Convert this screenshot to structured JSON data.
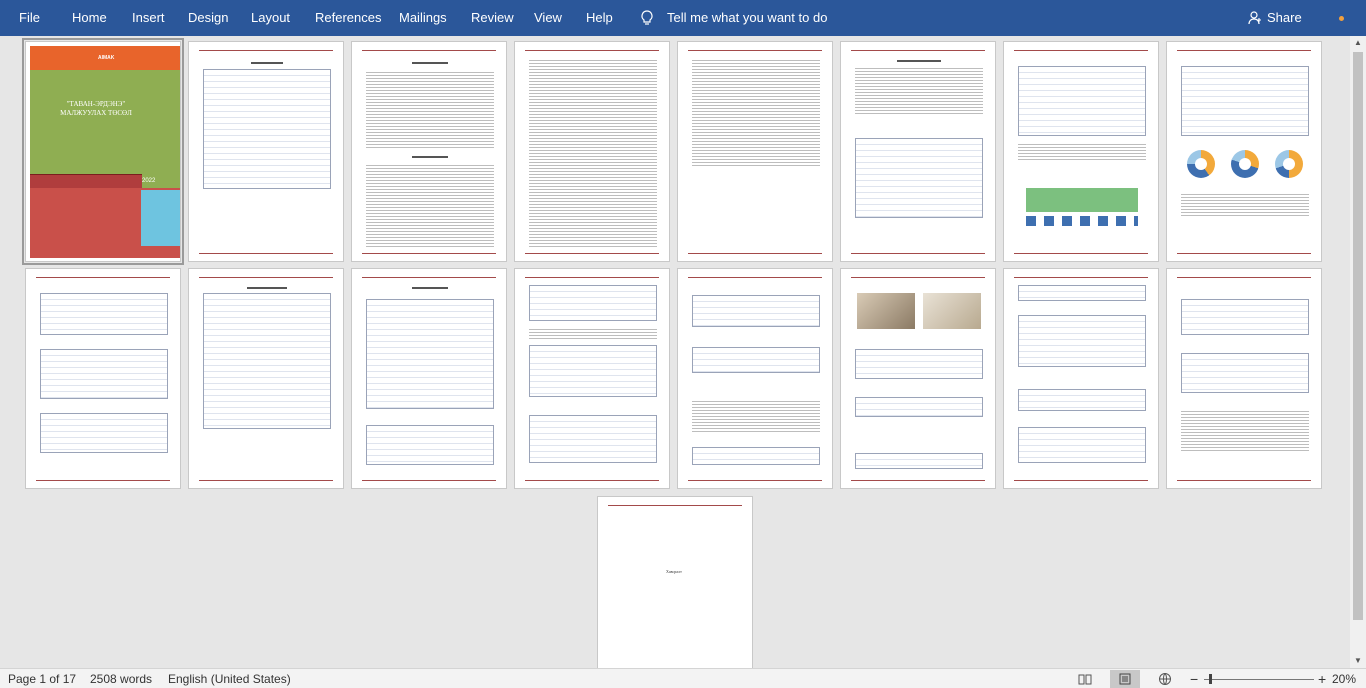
{
  "ribbon": {
    "tabs": [
      "File",
      "Home",
      "Insert",
      "Design",
      "Layout",
      "References",
      "Mailings",
      "Review",
      "View",
      "Help"
    ],
    "tell_me": "Tell me what you want to do",
    "share": "Share"
  },
  "cover": {
    "brand": "AIMAK",
    "title_line1": "\"ТАВАН-ЭРДЭНЭ\"",
    "title_line2": "МАЛЖУУЛАХ ТӨСӨЛ",
    "year": "2022"
  },
  "last_page_text": "Хавсралт",
  "status": {
    "page": "Page 1 of 17",
    "words": "2508 words",
    "language": "English (United States)",
    "zoom": "20%"
  },
  "colors": {
    "ribbon": "#2b579a",
    "cover_orange": "#e8642b",
    "cover_green": "#8fae52",
    "cover_red": "#c9504a",
    "cover_blue": "#6ec4e0"
  }
}
